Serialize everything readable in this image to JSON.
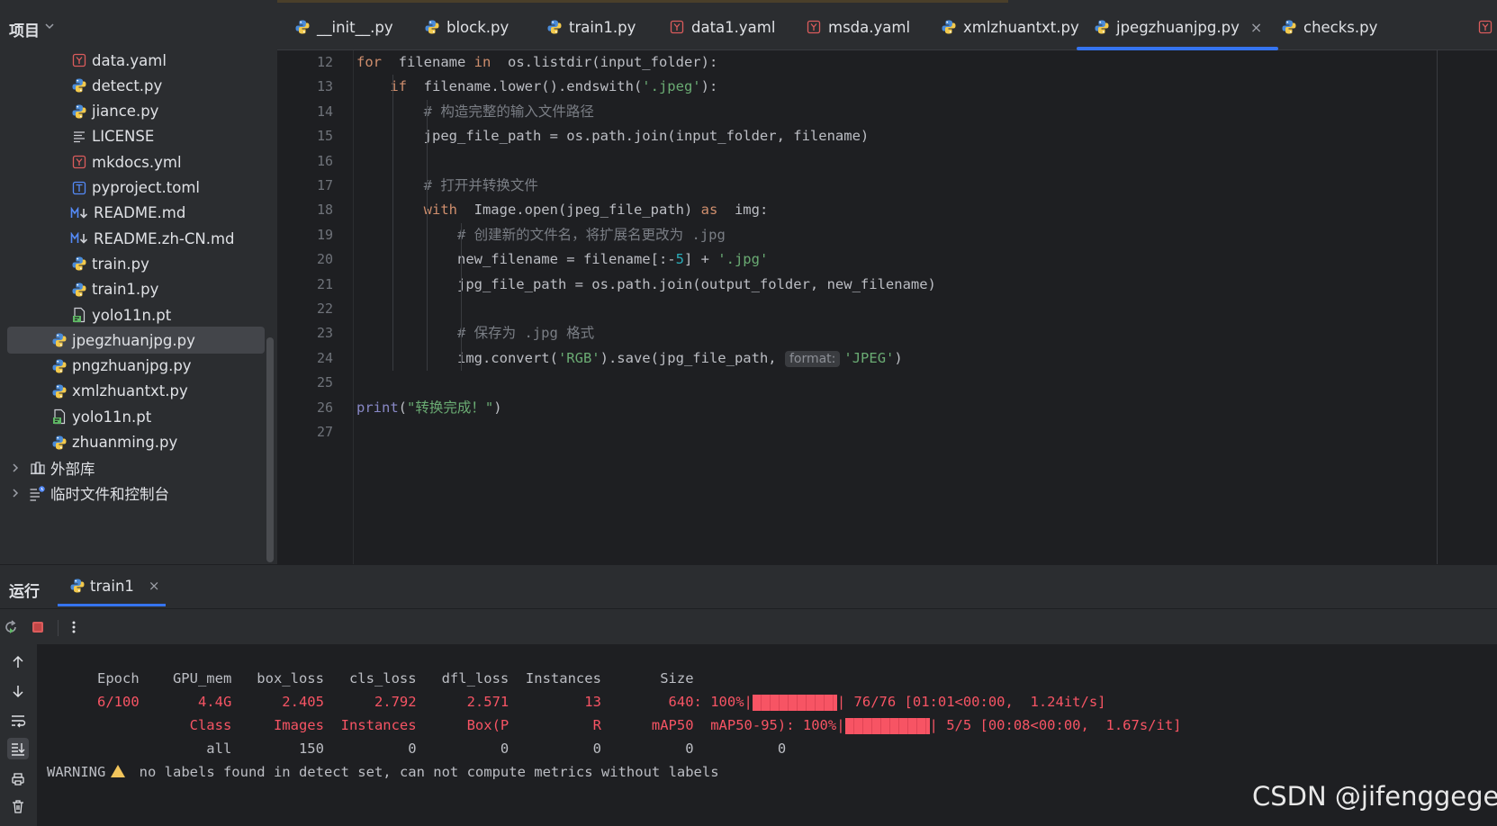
{
  "sidebar": {
    "title": "项目",
    "items": [
      {
        "label": "data.yaml",
        "icon": "yaml-icon",
        "indent": 2
      },
      {
        "label": "detect.py",
        "icon": "python-icon",
        "indent": 2
      },
      {
        "label": "jiance.py",
        "icon": "python-icon",
        "indent": 2
      },
      {
        "label": "LICENSE",
        "icon": "text-lines-icon",
        "indent": 2
      },
      {
        "label": "mkdocs.yml",
        "icon": "yaml-icon",
        "indent": 2
      },
      {
        "label": "pyproject.toml",
        "icon": "toml-icon",
        "indent": 2
      },
      {
        "label": "README.md",
        "icon": "markdown-icon",
        "indent": 2
      },
      {
        "label": "README.zh-CN.md",
        "icon": "markdown-icon",
        "indent": 2
      },
      {
        "label": "train.py",
        "icon": "python-icon",
        "indent": 2
      },
      {
        "label": "train1.py",
        "icon": "python-icon",
        "indent": 2
      },
      {
        "label": "yolo11n.pt",
        "icon": "binary-file-icon",
        "indent": 2
      },
      {
        "label": "jpegzhuanjpg.py",
        "icon": "python-icon",
        "indent": 1,
        "selected": true
      },
      {
        "label": "pngzhuanjpg.py",
        "icon": "python-icon",
        "indent": 1
      },
      {
        "label": "xmlzhuantxt.py",
        "icon": "python-icon",
        "indent": 1
      },
      {
        "label": "yolo11n.pt",
        "icon": "binary-file-icon",
        "indent": 1
      },
      {
        "label": "zhuanming.py",
        "icon": "python-icon",
        "indent": 1
      },
      {
        "label": "外部库",
        "icon": "library-icon",
        "indent": 0,
        "expandable": true
      },
      {
        "label": "临时文件和控制台",
        "icon": "scratches-icon",
        "indent": 0,
        "expandable": true
      }
    ]
  },
  "tabs": [
    {
      "label": "__init__.py",
      "icon": "python-icon"
    },
    {
      "label": "block.py",
      "icon": "python-icon"
    },
    {
      "label": "train1.py",
      "icon": "python-icon"
    },
    {
      "label": "data1.yaml",
      "icon": "yaml-icon"
    },
    {
      "label": "msda.yaml",
      "icon": "yaml-icon"
    },
    {
      "label": "xmlzhuantxt.py",
      "icon": "python-icon"
    },
    {
      "label": "jpegzhuanjpg.py",
      "icon": "python-icon",
      "active": true,
      "close": "×"
    },
    {
      "label": "checks.py",
      "icon": "python-icon"
    }
  ],
  "editor": {
    "line_numbers": [
      "12",
      "13",
      "14",
      "15",
      "16",
      "17",
      "18",
      "19",
      "20",
      "21",
      "22",
      "23",
      "24",
      "25",
      "26",
      "27"
    ],
    "lines": [
      [
        [
          "kw",
          "for"
        ],
        [
          "",
          "  filename "
        ],
        [
          "kw",
          "in"
        ],
        [
          "",
          "  os.listdir(input_folder):"
        ]
      ],
      [
        [
          "",
          "    "
        ],
        [
          "kw",
          "if"
        ],
        [
          "",
          "  filename.lower().endswith("
        ],
        [
          "str",
          "'.jpeg'"
        ],
        [
          "",
          "):"
        ]
      ],
      [
        [
          "",
          "        "
        ],
        [
          "cmt",
          "# 构造完整的输入文件路径"
        ]
      ],
      [
        [
          "",
          "        jpeg_file_path = os.path.join(input_folder, filename)"
        ]
      ],
      [],
      [
        [
          "",
          "        "
        ],
        [
          "cmt",
          "# 打开并转换文件"
        ]
      ],
      [
        [
          "",
          "        "
        ],
        [
          "kw",
          "with"
        ],
        [
          "",
          "  Image.open(jpeg_file_path) "
        ],
        [
          "kw",
          "as"
        ],
        [
          "",
          "  img:"
        ]
      ],
      [
        [
          "",
          "            "
        ],
        [
          "cmt",
          "# 创建新的文件名，将扩展名更改为 .jpg"
        ]
      ],
      [
        [
          "",
          "            new_filename = filename[:-"
        ],
        [
          "num",
          "5"
        ],
        [
          "",
          "] + "
        ],
        [
          "str",
          "'.jpg'"
        ]
      ],
      [
        [
          "",
          "            jpg_file_path = os.path.join(output_folder, new_filename)"
        ]
      ],
      [],
      [
        [
          "",
          "            "
        ],
        [
          "cmt",
          "# 保存为 .jpg 格式"
        ]
      ],
      [
        [
          "",
          "            img.convert("
        ],
        [
          "str",
          "'RGB'"
        ],
        [
          "",
          ").save(jpg_file_path, "
        ],
        [
          "hint",
          "format:"
        ],
        [
          "str",
          "'JPEG'"
        ],
        [
          "",
          ")"
        ]
      ],
      [],
      [
        [
          "bi",
          "print"
        ],
        [
          "",
          "("
        ],
        [
          "str",
          "\"转换完成！\""
        ],
        [
          "",
          ")"
        ]
      ],
      []
    ]
  },
  "run_panel": {
    "title": "运行",
    "tab_label": "train1",
    "tab_close": "×",
    "console": {
      "header": "      Epoch    GPU_mem   box_loss   cls_loss   dfl_loss  Instances       Size",
      "progress_line_pre": "      6/100       4.4G      2.405      2.792      2.571         13        640: 100%|",
      "progress_line_post": "| 76/76 [01:01<00:00,  1.24it/s]",
      "val_line_pre": "                 Class     Images  Instances      Box(P          R      mAP50  mAP50-95): 100%|",
      "val_line_post": "| 5/5 [00:08<00:00,  1.67s/it]",
      "result_line": "                   all        150          0          0          0          0          0",
      "warning_label": "WARNING",
      "warning_text": " no labels found in detect set, can not compute metrics without labels",
      "train_progress": 1.0,
      "val_progress": 1.0
    }
  },
  "watermark": "CSDN @jifenggege",
  "colors": {
    "keyword": "#cf8e6d",
    "string": "#6aab73",
    "comment": "#7a7e85",
    "console_red": "#f75464",
    "accent": "#3574f0"
  }
}
